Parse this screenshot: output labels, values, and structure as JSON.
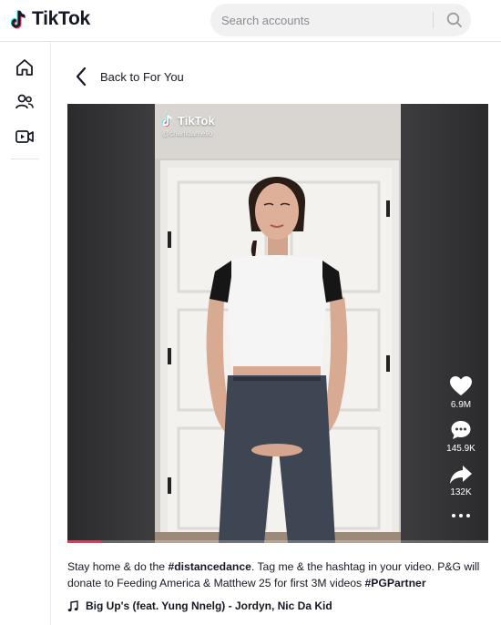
{
  "header": {
    "logo_text": "TikTok",
    "search_placeholder": "Search accounts"
  },
  "sidebar": {
    "items": [
      {
        "icon": "home-icon",
        "label": ""
      },
      {
        "icon": "following-icon",
        "label": ""
      },
      {
        "icon": "live-video-icon",
        "label": ""
      }
    ]
  },
  "back": {
    "label": "Back to For You"
  },
  "video": {
    "watermark_title": "TikTok",
    "watermark_user": "@charlidamello",
    "progress": 0.08,
    "actions": {
      "likes": "6.9M",
      "comments": "145.9K",
      "shares": "132K"
    }
  },
  "caption": {
    "before_tag1": "Stay home & do the ",
    "tag1": "#distancedance",
    "middle": ". Tag me & the hashtag in your video. P&G will donate to Feeding America & Matthew 25 for first 3M videos ",
    "tag2": "#PGPartner"
  },
  "music": {
    "icon": "music-note-icon",
    "title": "Big Up's (feat. Yung Nnelg) - Jordyn, Nic Da Kid"
  },
  "colors": {
    "accent": "#fe2c55",
    "cyan": "#25f4ee",
    "text": "#161823"
  }
}
